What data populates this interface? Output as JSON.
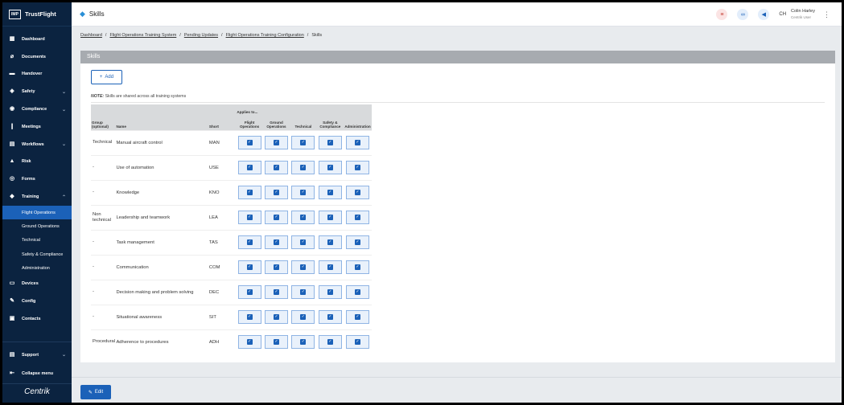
{
  "app": {
    "logo_box": "IMP",
    "logo_text": "TrustFlight",
    "brand": "Centrik"
  },
  "header": {
    "title": "Skills",
    "initials": "CH",
    "user_name": "Colin Harley",
    "user_role": "Centrik User"
  },
  "sidebar": {
    "items": [
      {
        "label": "Dashboard",
        "icon": "dashboard-icon",
        "chevron": false
      },
      {
        "label": "Documents",
        "icon": "paperclip-icon",
        "chevron": false
      },
      {
        "label": "Handover",
        "icon": "handover-icon",
        "chevron": false
      },
      {
        "label": "Safety",
        "icon": "shield-icon",
        "chevron": true
      },
      {
        "label": "Compliance",
        "icon": "badge-icon",
        "chevron": true
      },
      {
        "label": "Meetings",
        "icon": "meetings-icon",
        "chevron": false
      },
      {
        "label": "Workflows",
        "icon": "workflows-icon",
        "chevron": true
      },
      {
        "label": "Risk",
        "icon": "risk-icon",
        "chevron": false
      },
      {
        "label": "Forms",
        "icon": "forms-icon",
        "chevron": false
      },
      {
        "label": "Training",
        "icon": "graduation-cap-icon",
        "chevron": true
      }
    ],
    "training_sub": [
      "Flight Operations",
      "Ground Operations",
      "Technical",
      "Safety & Compliance",
      "Administration"
    ],
    "items_after": [
      {
        "label": "Devices",
        "icon": "devices-icon"
      },
      {
        "label": "Config",
        "icon": "wrench-icon"
      },
      {
        "label": "Contacts",
        "icon": "contacts-icon"
      }
    ],
    "support": "Support",
    "collapse": "Collapse menu"
  },
  "breadcrumb": [
    "Dashboard",
    "Flight Operations Training System",
    "Pending Updates",
    "Flight Operations Training Configuration",
    "Skills"
  ],
  "panel": {
    "title": "Skills",
    "add_label": "Add",
    "note_prefix": "NOTE:",
    "note_text": " Skills are shared across all training systems"
  },
  "table": {
    "applies_to": "Applies to...",
    "headers": {
      "group": "Group (optional)",
      "name": "Name",
      "short": "Short",
      "flight": "Flight Operations",
      "ground": "Ground Operations",
      "technical": "Technical",
      "safety": "Safety & Compliance",
      "admin": "Administration"
    },
    "rows": [
      {
        "group": "Technical",
        "name": "Manual aircraft control",
        "short": "MAN"
      },
      {
        "group": "-",
        "name": "Use of automation",
        "short": "USE"
      },
      {
        "group": "-",
        "name": "Knowledge",
        "short": "KNO"
      },
      {
        "group": "Non technical",
        "name": "Leadership and teamwork",
        "short": "LEA"
      },
      {
        "group": "-",
        "name": "Task management",
        "short": "TAS"
      },
      {
        "group": "-",
        "name": "Communication",
        "short": "COM"
      },
      {
        "group": "-",
        "name": "Decision making and problem solving",
        "short": "DEC"
      },
      {
        "group": "-",
        "name": "Situational awareness",
        "short": "SIT"
      },
      {
        "group": "Procedural",
        "name": "Adherence to procedures",
        "short": "ADH"
      }
    ]
  },
  "footer": {
    "edit_label": "Edit"
  },
  "colors": {
    "sidebar": "#0b2340",
    "accent": "#1b61b8",
    "panel_header": "#a7abb0"
  }
}
